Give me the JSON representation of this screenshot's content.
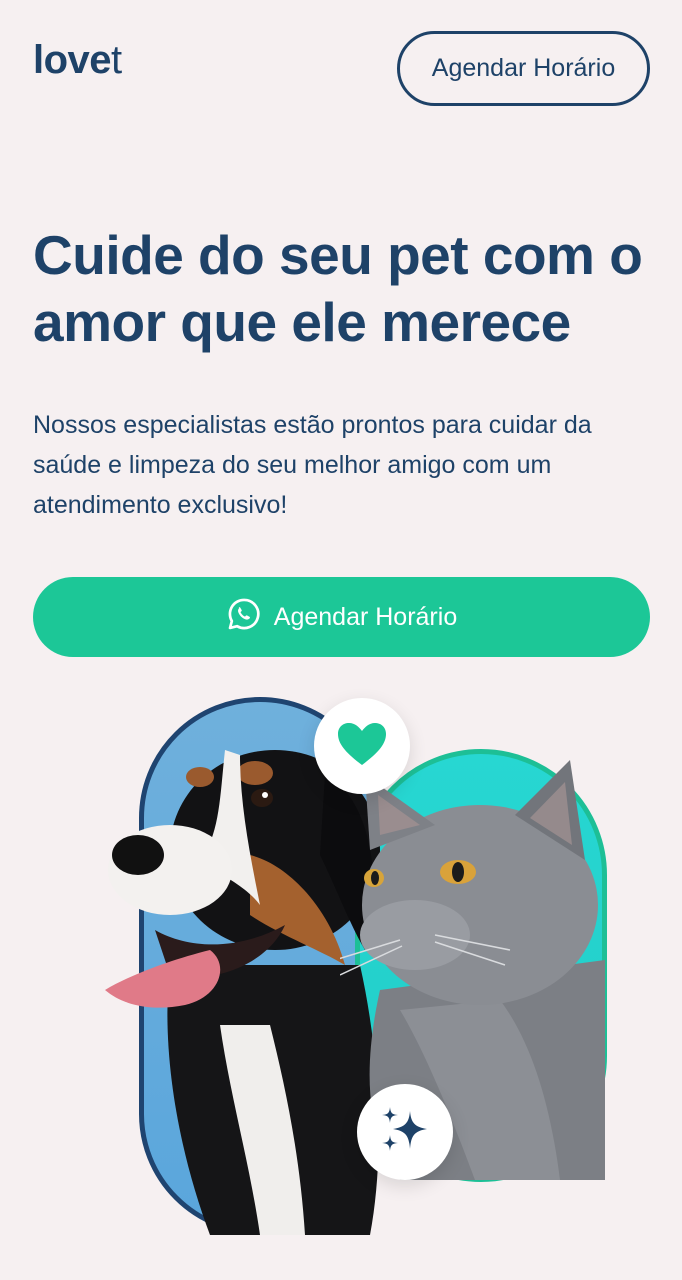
{
  "header": {
    "logo_bold": "love",
    "logo_light": "t",
    "cta_label": "Agendar Horário"
  },
  "hero": {
    "headline": "Cuide do seu pet com o amor que ele merece",
    "subtext": "Nossos especialistas estão prontos para cuidar da saúde e limpeza do seu melhor amigo com um atendimento exclusivo!",
    "cta_label": "Agendar Horário",
    "cta_icon": "whatsapp-icon"
  },
  "illustration": {
    "left_image": "dog-photo",
    "right_image": "cat-photo",
    "top_badge_icon": "heart-icon",
    "bottom_badge_icon": "sparkles-icon"
  },
  "colors": {
    "primary_text": "#1e4268",
    "background": "#f6f0f1",
    "accent_green": "#1cc797",
    "dog_frame": "#5aa6dc",
    "cat_frame": "#22ccc7"
  }
}
